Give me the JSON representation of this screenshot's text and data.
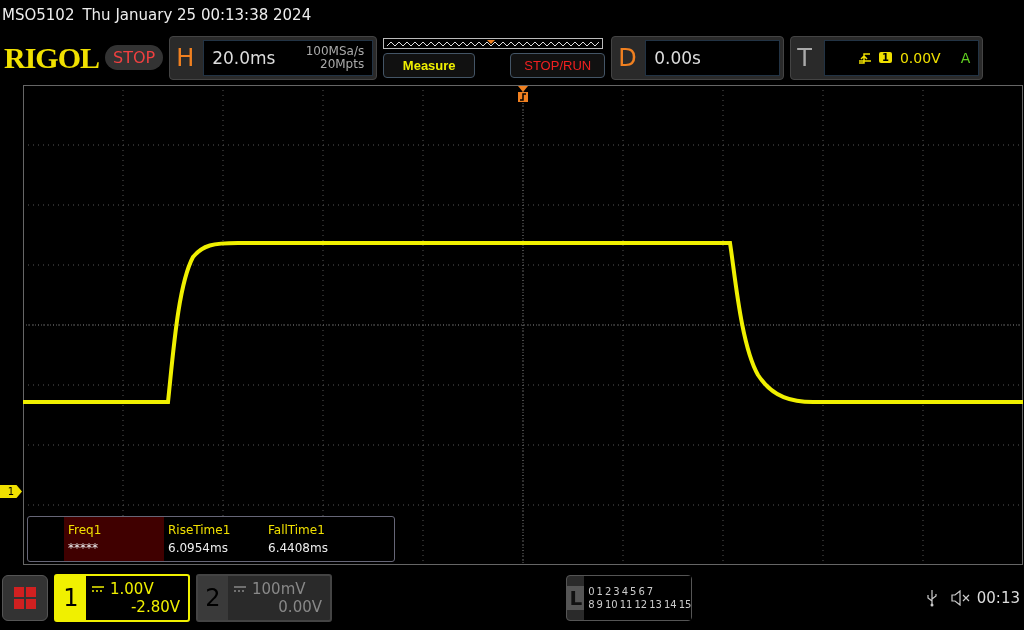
{
  "header": {
    "model": "MSO5102",
    "datetime": "Thu January 25 00:13:38 2024"
  },
  "logo": "RIGOL",
  "run_state": "STOP",
  "horizontal": {
    "label": "H",
    "timebase": "20.0ms",
    "sample_rate": "100MSa/s",
    "memory_depth": "20Mpts"
  },
  "buttons": [
    {
      "label": "Measure",
      "kind": "measure"
    },
    {
      "label": "STOP/RUN",
      "kind": "stoprun"
    }
  ],
  "delay": {
    "label": "D",
    "value": "0.00s"
  },
  "trigger": {
    "label": "T",
    "source": "1",
    "level": "0.00V",
    "mode": "A"
  },
  "ground_marker": "1",
  "measurements": [
    {
      "name": "Freq1",
      "value": "*****",
      "selected": true
    },
    {
      "name": "RiseTime1",
      "value": "6.0954ms",
      "selected": false
    },
    {
      "name": "FallTime1",
      "value": "6.4408ms",
      "selected": false
    }
  ],
  "channels": [
    {
      "number": "1",
      "scale": "1.00V",
      "offset": "-2.80V",
      "on": true
    },
    {
      "number": "2",
      "scale": "100mV",
      "offset": "0.00V",
      "on": false
    }
  ],
  "logic": {
    "label": "L",
    "row_1": [
      "0",
      "1",
      "2",
      "3",
      "4",
      "5",
      "6",
      "7"
    ],
    "row_2": [
      "8",
      "9",
      "10",
      "11",
      "12",
      "13",
      "14",
      "15"
    ]
  },
  "status": {
    "time": "00:13"
  }
}
